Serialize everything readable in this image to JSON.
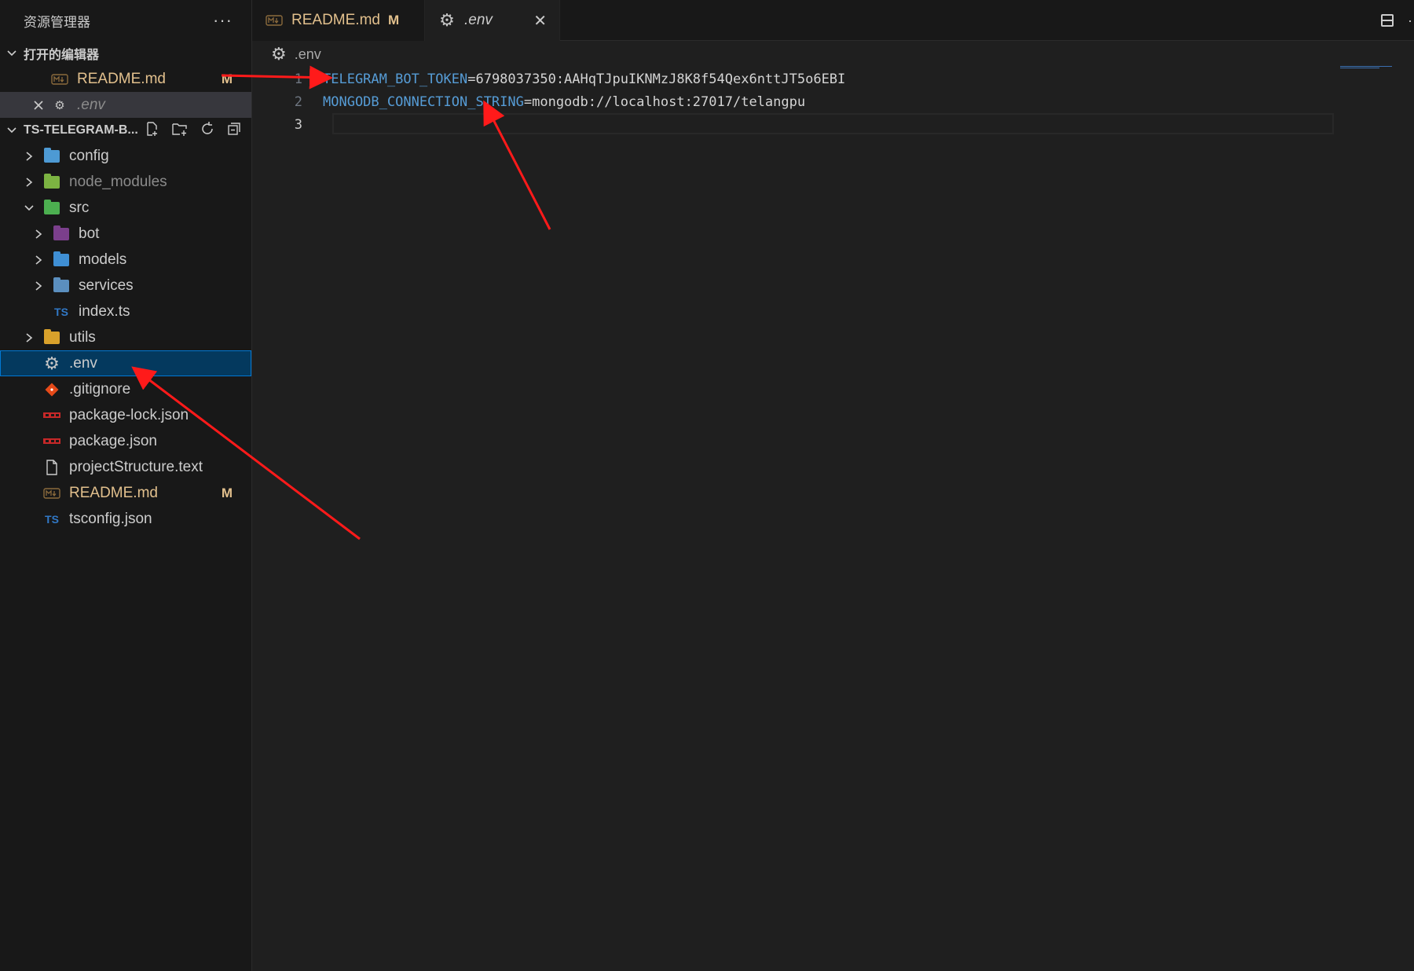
{
  "explorer": {
    "title": "资源管理器",
    "more_label": "···",
    "open_editors": {
      "title": "打开的编辑器",
      "items": [
        {
          "label": "README.md",
          "badge": "M"
        },
        {
          "label": ".env"
        }
      ]
    },
    "project": {
      "title": "TS-TELEGRAM-B...",
      "items": [
        {
          "label": "config"
        },
        {
          "label": "node_modules"
        },
        {
          "label": "src"
        },
        {
          "label": "bot"
        },
        {
          "label": "models"
        },
        {
          "label": "services"
        },
        {
          "label": "index.ts",
          "icon_text": "TS"
        },
        {
          "label": "utils"
        },
        {
          "label": ".env"
        },
        {
          "label": ".gitignore"
        },
        {
          "label": "package-lock.json"
        },
        {
          "label": "package.json"
        },
        {
          "label": "projectStructure.text"
        },
        {
          "label": "README.md",
          "badge": "M"
        },
        {
          "label": "tsconfig.json",
          "icon_text": "TS"
        }
      ]
    }
  },
  "tabs": [
    {
      "label": "README.md",
      "badge": "M"
    },
    {
      "label": ".env",
      "close": "✕"
    }
  ],
  "breadcrumb": ".env",
  "editor": {
    "lines": [
      {
        "num": "1",
        "key": "TELEGRAM_BOT_TOKEN",
        "value": "=6798037350:AAHqTJpuIKNMzJ8K8f54Qex6nttJT5o6EBI"
      },
      {
        "num": "2",
        "key": "MONGODB_CONNECTION_STRING",
        "value": "=mongodb://localhost:27017/telangpu"
      },
      {
        "num": "3",
        "key": "",
        "value": ""
      }
    ]
  },
  "colors": {
    "accent": "#0078d4",
    "modified": "#e2c08d",
    "key": "#569cd6",
    "annotation_arrow": "#ff1a1a"
  }
}
